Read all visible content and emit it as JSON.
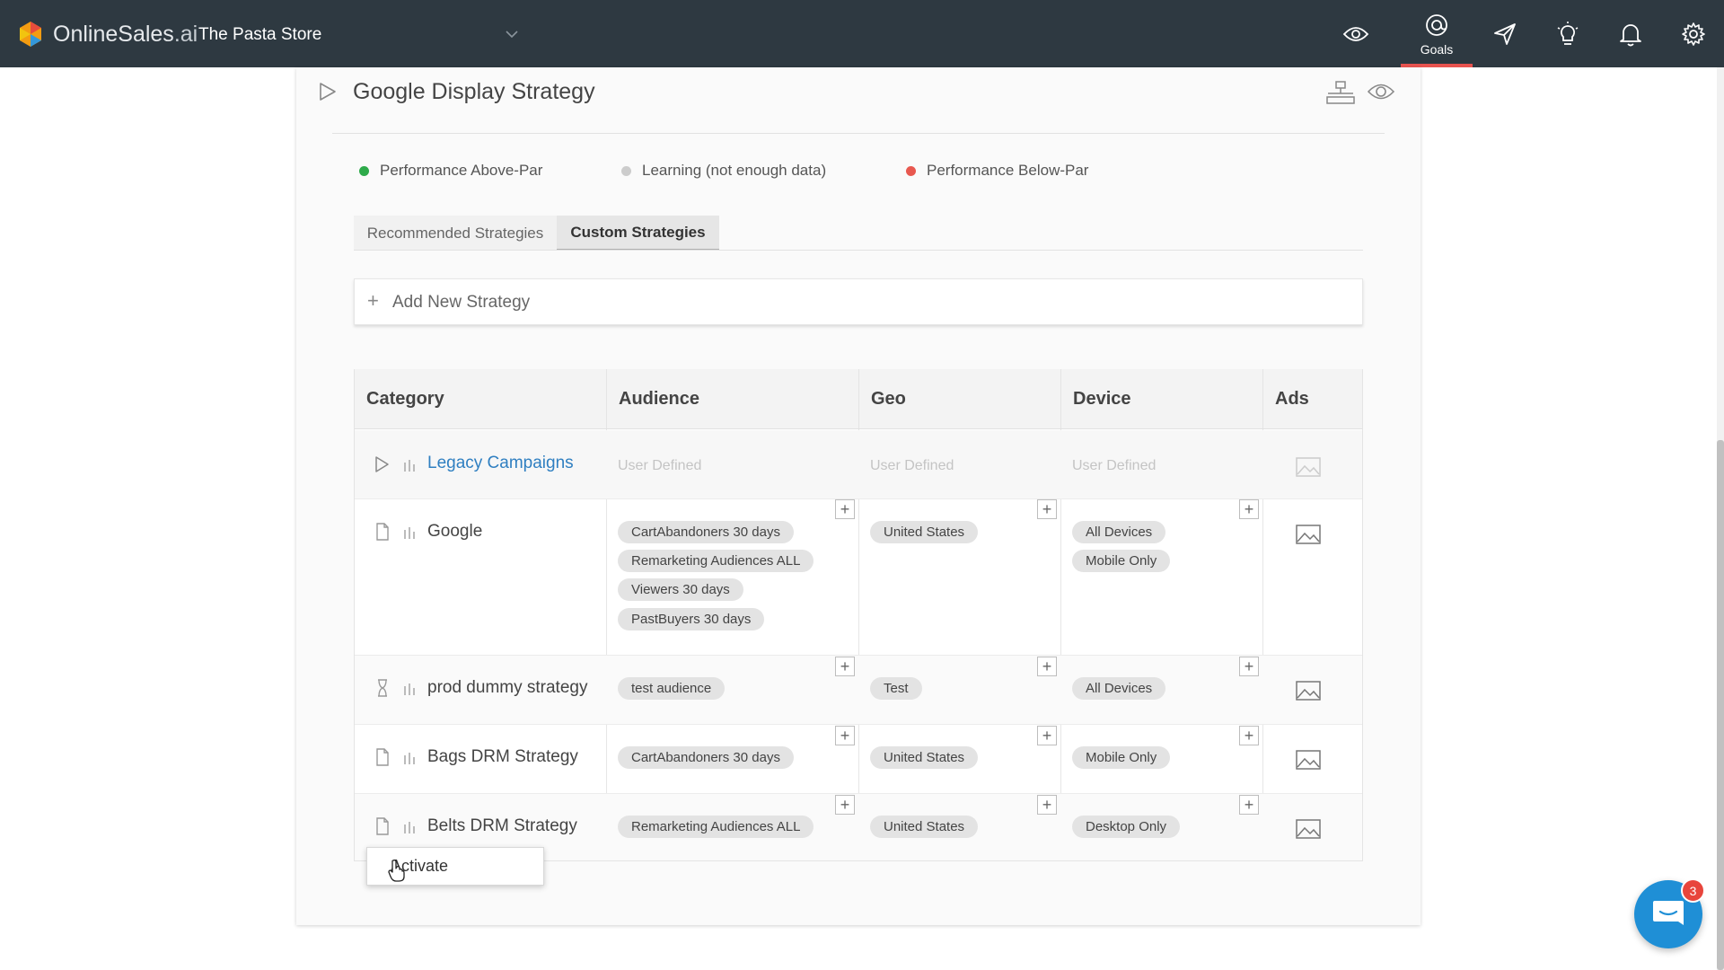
{
  "header": {
    "brand_main": "OnlineSales",
    "brand_suffix": ".ai",
    "store_name": "The Pasta Store",
    "goals_label": "Goals"
  },
  "strategy": {
    "title": "Google Display Strategy"
  },
  "legend": [
    {
      "label": "Performance Above-Par",
      "color": "#2eaa4a"
    },
    {
      "label": "Learning (not enough data)",
      "color": "#cccccc"
    },
    {
      "label": "Performance Below-Par",
      "color": "#e8584f"
    }
  ],
  "tabs": {
    "recommended": "Recommended Strategies",
    "custom": "Custom Strategies"
  },
  "add_strategy": {
    "label": "Add New Strategy"
  },
  "table": {
    "headers": {
      "category": "Category",
      "audience": "Audience",
      "geo": "Geo",
      "device": "Device",
      "ads": "Ads"
    },
    "legacy": {
      "name": "Legacy Campaigns",
      "audience": "User Defined",
      "geo": "User Defined",
      "device": "User Defined"
    },
    "rows": [
      {
        "name": "Google",
        "audience": [
          "CartAbandoners 30 days",
          "Remarketing Audiences ALL",
          "Viewers 30 days",
          "PastBuyers 30 days"
        ],
        "geo": [
          "United States"
        ],
        "device": [
          "All Devices",
          "Mobile Only"
        ]
      },
      {
        "name": "prod dummy strategy",
        "audience": [
          "test audience"
        ],
        "geo": [
          "Test"
        ],
        "device": [
          "All Devices"
        ]
      },
      {
        "name": "Bags DRM Strategy",
        "audience": [
          "CartAbandoners 30 days"
        ],
        "geo": [
          "United States"
        ],
        "device": [
          "Mobile Only"
        ]
      },
      {
        "name": "Belts DRM Strategy",
        "audience": [
          "Remarketing Audiences ALL"
        ],
        "geo": [
          "United States"
        ],
        "device": [
          "Desktop Only"
        ]
      }
    ]
  },
  "popup": {
    "activate": "Activate"
  },
  "chat": {
    "badge": "3"
  },
  "colors": {
    "topbar": "#2e3941",
    "accent": "#e8534f",
    "link": "#2f7fc1",
    "chat": "#1f8fd6"
  }
}
